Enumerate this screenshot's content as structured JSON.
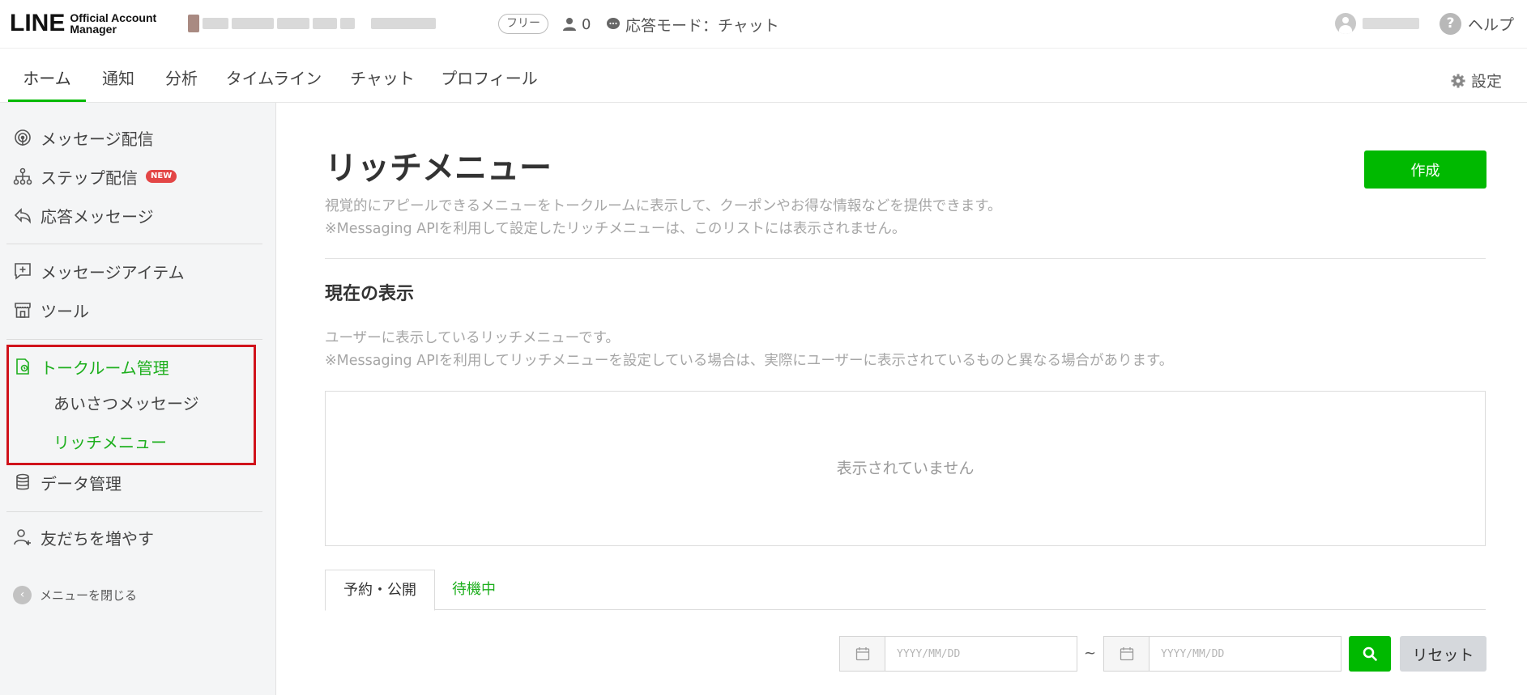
{
  "header": {
    "logo_main": "LINE",
    "logo_sub_line1": "Official Account",
    "logo_sub_line2": "Manager",
    "plan_badge": "フリー",
    "friends_count": "0",
    "response_mode": "応答モード：チャット",
    "help_label": "ヘルプ",
    "icons": [
      "person-icon",
      "chat-bubble-icon",
      "user-avatar-icon",
      "help-icon"
    ]
  },
  "nav": {
    "tabs": [
      {
        "label": "ホーム",
        "active": true
      },
      {
        "label": "通知",
        "active": false
      },
      {
        "label": "分析",
        "active": false
      },
      {
        "label": "タイムライン",
        "active": false
      },
      {
        "label": "チャット",
        "active": false
      },
      {
        "label": "プロフィール",
        "active": false
      }
    ],
    "settings_label": "設定"
  },
  "sidebar": {
    "items": [
      {
        "label": "メッセージ配信",
        "icon": "broadcast-icon"
      },
      {
        "label": "ステップ配信",
        "icon": "step-tree-icon",
        "badge": "NEW"
      },
      {
        "label": "応答メッセージ",
        "icon": "reply-icon"
      },
      {
        "label": "メッセージアイテム",
        "icon": "message-add-icon"
      },
      {
        "label": "ツール",
        "icon": "store-icon"
      },
      {
        "label": "トークルーム管理",
        "icon": "talkroom-icon",
        "active": true
      },
      {
        "label": "データ管理",
        "icon": "database-icon"
      },
      {
        "label": "友だちを増やす",
        "icon": "add-friend-icon"
      }
    ],
    "subitems": [
      {
        "label": "あいさつメッセージ",
        "active": false
      },
      {
        "label": "リッチメニュー",
        "active": true
      }
    ],
    "close_menu_label": "メニューを閉じる"
  },
  "main": {
    "title": "リッチメニュー",
    "create_label": "作成",
    "description_line1": "視覚的にアピールできるメニューをトークルームに表示して、クーポンやお得な情報などを提供できます。",
    "description_line2": "※Messaging APIを利用して設定したリッチメニューは、このリストには表示されません。",
    "current_section_title": "現在の表示",
    "current_desc_line1": "ユーザーに表示しているリッチメニューです。",
    "current_desc_line2": "※Messaging APIを利用してリッチメニューを設定している場合は、実際にユーザーに表示されているものと異なる場合があります。",
    "empty_text": "表示されていません",
    "tabs": [
      {
        "label": "予約・公開",
        "active": true
      },
      {
        "label": "待機中",
        "active": false
      }
    ],
    "date_from_placeholder": "YYYY/MM/DD",
    "date_to_placeholder": "YYYY/MM/DD",
    "range_separator": "~",
    "reset_label": "リセット"
  },
  "colors": {
    "brand_green": "#00b900",
    "active_green": "#1eaf1e",
    "highlight_red": "#d0121b",
    "new_badge": "#e34646"
  }
}
